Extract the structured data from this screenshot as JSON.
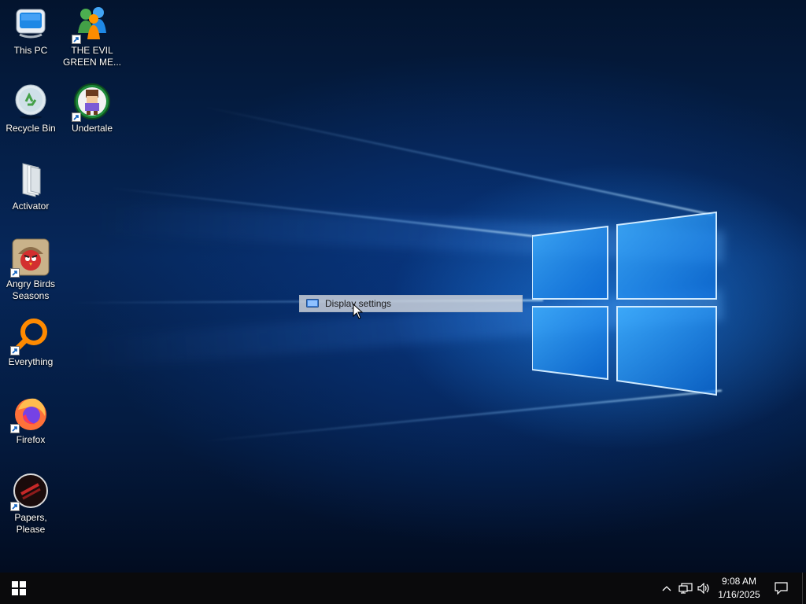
{
  "desktop": {
    "icons": [
      {
        "label": "This PC",
        "icon": "computer-icon",
        "shortcut": false
      },
      {
        "label": "THE EVIL GREEN ME...",
        "icon": "messenger-icon",
        "shortcut": true
      },
      {
        "label": "Recycle Bin",
        "icon": "recycle-bin-icon",
        "shortcut": false
      },
      {
        "label": "Undertale",
        "icon": "undertale-icon",
        "shortcut": true
      },
      {
        "label": "Activator",
        "icon": "folder-icon",
        "shortcut": false
      },
      {
        "label": "Angry Birds Seasons",
        "icon": "angry-birds-icon",
        "shortcut": true
      },
      {
        "label": "Everything",
        "icon": "everything-search-icon",
        "shortcut": true
      },
      {
        "label": "Firefox",
        "icon": "firefox-icon",
        "shortcut": true
      },
      {
        "label": "Papers, Please",
        "icon": "papers-please-icon",
        "shortcut": true
      }
    ]
  },
  "context_menu": {
    "items": [
      {
        "label": "Display settings",
        "icon": "display-icon"
      }
    ]
  },
  "taskbar": {
    "start_icon": "windows-logo-icon",
    "tray_icons": [
      "chevron-up-icon",
      "network-icon",
      "volume-icon"
    ],
    "time": "9:08 AM",
    "date": "1/16/2025",
    "notification_icon": "action-center-icon"
  },
  "colors": {
    "taskbar_bg": "#0a0a0c",
    "wallpaper_accent": "#2a96ff",
    "menu_bg": "#d2d7de"
  }
}
